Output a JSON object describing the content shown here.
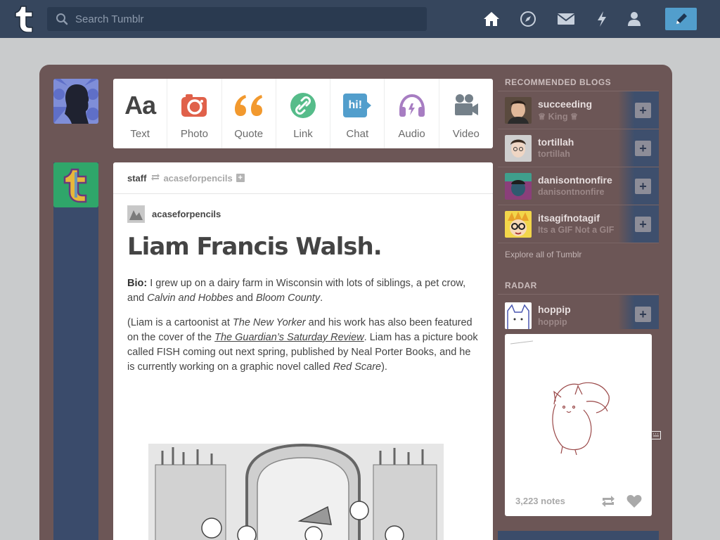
{
  "search": {
    "placeholder": "Search Tumblr"
  },
  "header": {
    "nav": [
      "home-icon",
      "explore-icon",
      "inbox-icon",
      "activity-icon",
      "account-icon"
    ],
    "compose": "pencil-icon"
  },
  "post_types": [
    {
      "label": "Text",
      "icon": "Aa"
    },
    {
      "label": "Photo",
      "icon": "camera-icon"
    },
    {
      "label": "Quote",
      "icon": "quote-icon"
    },
    {
      "label": "Link",
      "icon": "link-icon"
    },
    {
      "label": "Chat",
      "icon": "hi!"
    },
    {
      "label": "Audio",
      "icon": "headphones-icon"
    },
    {
      "label": "Video",
      "icon": "video-camera-icon"
    }
  ],
  "post": {
    "author": "staff",
    "reblogged_from": "acaseforpencils",
    "source": "acaseforpencils",
    "title": "Liam Francis Walsh.",
    "bio_label": "Bio:",
    "bio_p1_a": " I grew up on a dairy farm in Wisconsin with lots of siblings, a pet crow, and ",
    "bio_p1_em1": "Calvin and Hobbes",
    "bio_p1_b": " and ",
    "bio_p1_em2": "Bloom County",
    "bio_p1_c": ".",
    "p2_a": "(Liam is a cartoonist at ",
    "p2_em1": "The New Yorker",
    "p2_b": " and his work has also been featured on the cover of the ",
    "p2_link": "The Guardian’s Saturday Review",
    "p2_c": ". Liam has a picture book called FISH coming out next spring, published by Neal Porter Books, and he is currently working on a graphic novel called ",
    "p2_em2": "Red Scare",
    "p2_d": ")."
  },
  "sidebar": {
    "recommended_heading": "RECOMMENDED BLOGS",
    "blogs": [
      {
        "name": "succeeding",
        "subtitle": "♕ King ♕"
      },
      {
        "name": "tortillah",
        "subtitle": "tortillah"
      },
      {
        "name": "danisontnonfire",
        "subtitle": "danisontnonfire"
      },
      {
        "name": "itsagifnotagif",
        "subtitle": "Its a GIF Not a GIF"
      }
    ],
    "explore": "Explore all of Tumblr",
    "radar_heading": "RADAR",
    "radar": {
      "name": "hoppip",
      "subtitle": "hoppip",
      "notes": "3,223 notes"
    }
  },
  "colors": {
    "topbar": "#36465d",
    "dashboard": "#6c5656",
    "accent": "#529ecc"
  }
}
